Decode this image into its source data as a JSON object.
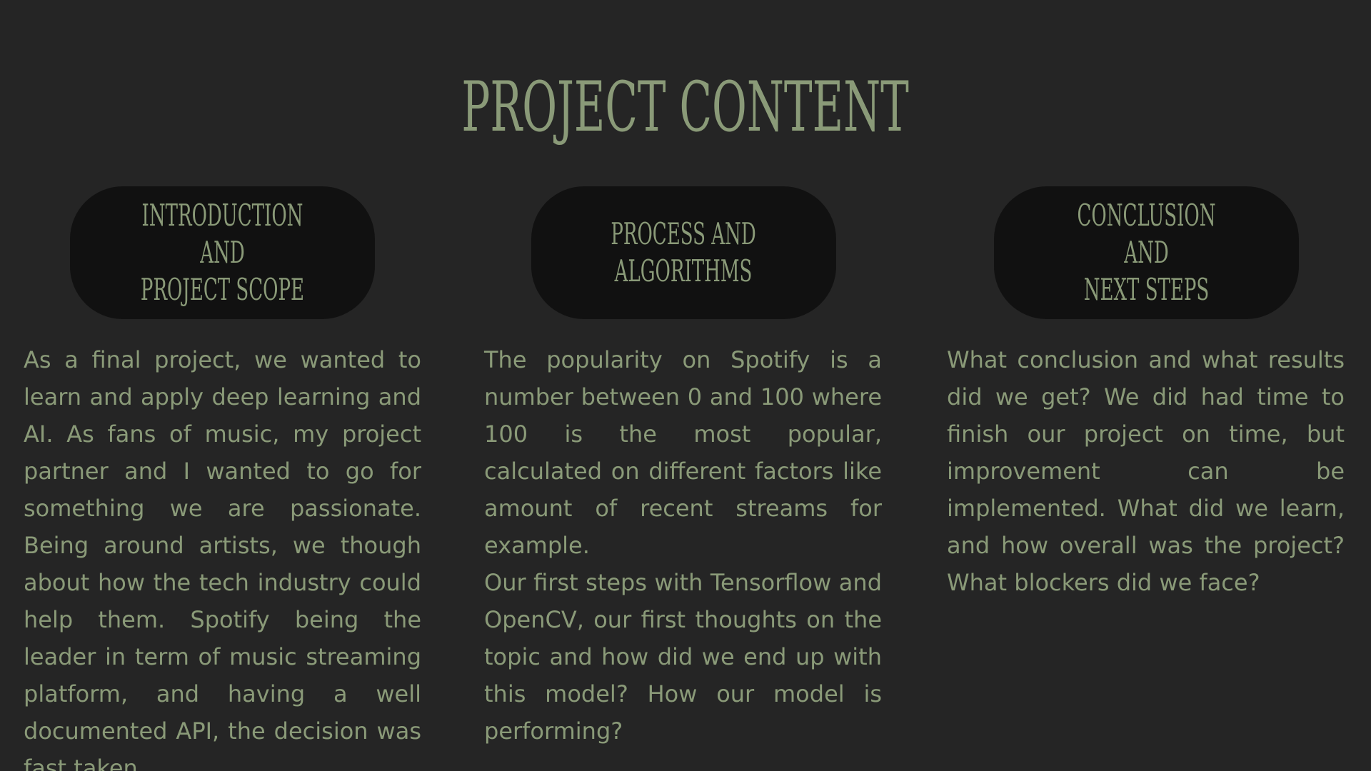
{
  "slide": {
    "title": "PROJECT CONTENT"
  },
  "sections": [
    {
      "heading": "INTRODUCTION AND\nPROJECT SCOPE",
      "paragraphs": [
        "As a final project, we wanted to learn and apply deep learning and AI. As fans of music, my project partner and I wanted to go for something we are passionate. Being around artists, we though about how the tech industry could help them.  Spotify being the leader in term of music streaming platform, and having a well documented API, the decision was fast taken."
      ]
    },
    {
      "heading": "PROCESS AND\nALGORITHMS",
      "paragraphs": [
        "The popularity on Spotify is a number between 0 and 100 where 100 is the most popular, calculated on different factors like amount of recent streams for example.",
        "Our first steps with Tensorflow and OpenCV, our first thoughts on the topic and how did we end up with this model? How our model is performing?"
      ]
    },
    {
      "heading": "CONCLUSION AND\nNEXT STEPS",
      "paragraphs": [
        "What conclusion and what results did we get? We did had time to finish our project on time, but improvement can be implemented. What did we learn, and how overall was the project? What blockers did we face?"
      ]
    }
  ]
}
